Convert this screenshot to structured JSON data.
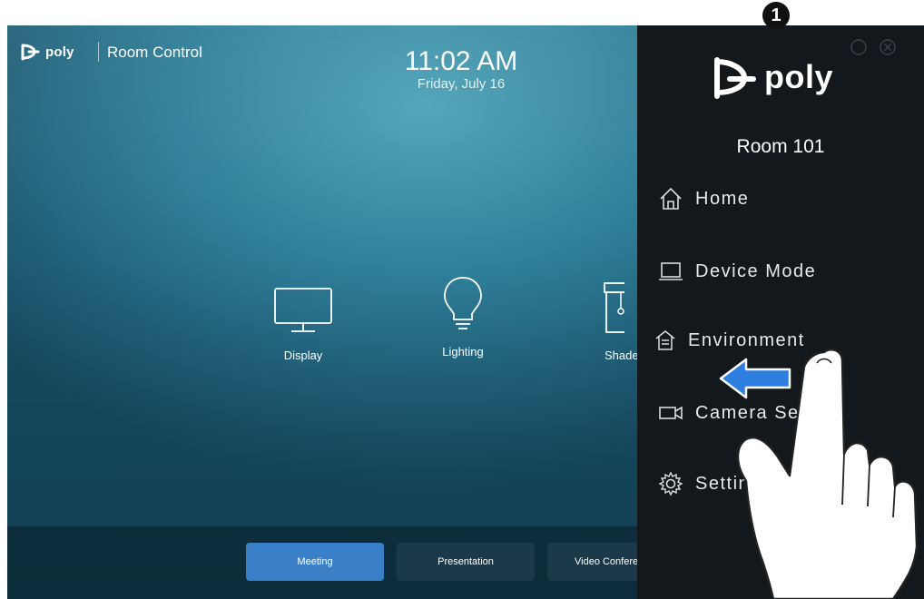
{
  "header": {
    "brand": "poly",
    "app_title": "Room Control",
    "time": "11:02 AM",
    "date": "Friday, July 16"
  },
  "tiles": [
    {
      "label": "Display",
      "icon": "display-icon"
    },
    {
      "label": "Lighting",
      "icon": "lightbulb-icon"
    },
    {
      "label": "Shade",
      "icon": "shades-icon"
    }
  ],
  "modes": [
    {
      "label": "Meeting",
      "active": true
    },
    {
      "label": "Presentation",
      "active": false
    },
    {
      "label": "Video Confere",
      "active": false
    }
  ],
  "panel": {
    "brand": "poly",
    "room": "Room 101",
    "items": [
      {
        "label": "Home",
        "icon": "home-icon"
      },
      {
        "label": "Device Mode",
        "icon": "laptop-icon"
      },
      {
        "label": "Environment",
        "icon": "environment-icon"
      },
      {
        "label": "Camera Se  ngs",
        "icon": "camera-icon"
      },
      {
        "label": "Settin",
        "icon": "gear-icon"
      }
    ]
  },
  "annotation": {
    "step": "1"
  },
  "colors": {
    "accent": "#3a80c9",
    "panel_bg": "#12181b",
    "screen_bg": "#2f7f99",
    "arrow": "#2f7fe0"
  }
}
